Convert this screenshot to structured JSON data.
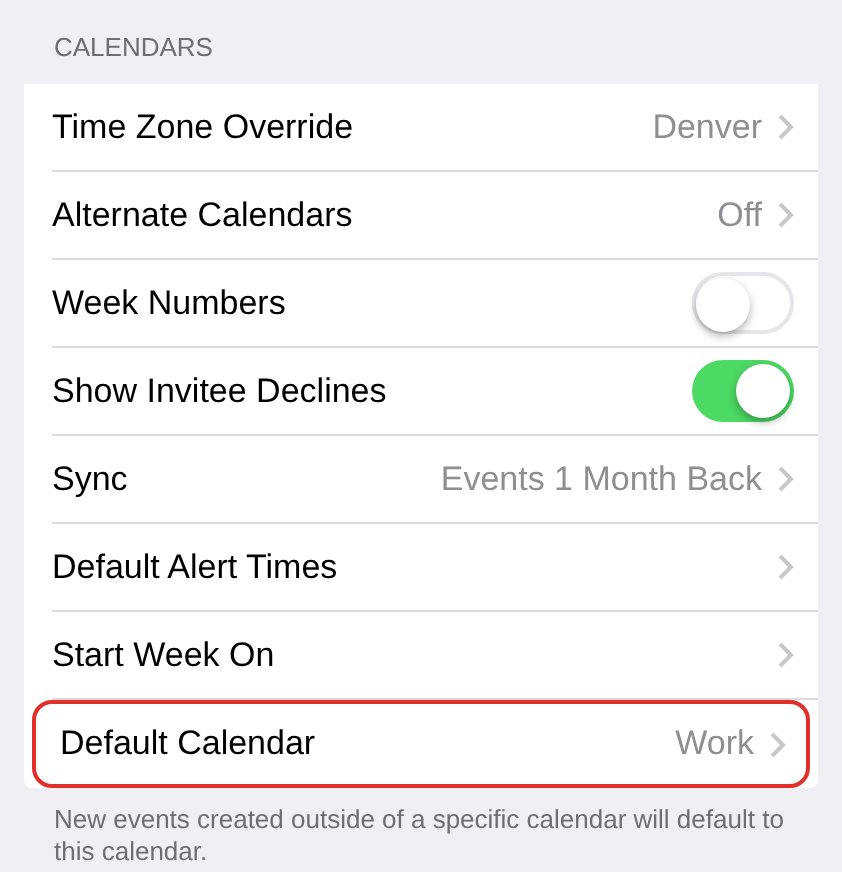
{
  "section": {
    "title": "CALENDARS"
  },
  "rows": [
    {
      "kind": "disclosure",
      "label": "Time Zone Override",
      "value": "Denver",
      "highlighted": false
    },
    {
      "kind": "disclosure",
      "label": "Alternate Calendars",
      "value": "Off",
      "highlighted": false
    },
    {
      "kind": "toggle",
      "label": "Week Numbers",
      "on": false,
      "highlighted": false
    },
    {
      "kind": "toggle",
      "label": "Show Invitee Declines",
      "on": true,
      "highlighted": false
    },
    {
      "kind": "disclosure",
      "label": "Sync",
      "value": "Events 1 Month Back",
      "highlighted": false
    },
    {
      "kind": "disclosure",
      "label": "Default Alert Times",
      "highlighted": false
    },
    {
      "kind": "disclosure",
      "label": "Start Week On",
      "highlighted": false
    },
    {
      "kind": "disclosure",
      "label": "Default Calendar",
      "value": "Work",
      "highlighted": true
    }
  ],
  "footer": "New events created outside of a specific calendar will default to this calendar."
}
